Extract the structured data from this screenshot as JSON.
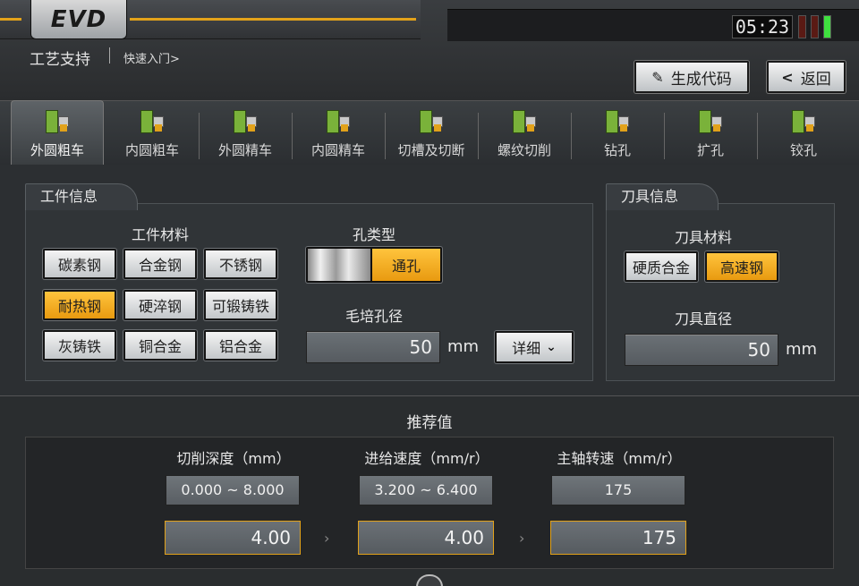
{
  "header": {
    "logo": "EVD",
    "title": "工艺支持",
    "breadcrumb": "快速入门>",
    "clock": "05:23",
    "buttons": {
      "generate": "生成代码",
      "back": "返回"
    }
  },
  "tabs": [
    {
      "label": "外圆粗车",
      "active": true
    },
    {
      "label": "内圆粗车",
      "active": false
    },
    {
      "label": "外圆精车",
      "active": false
    },
    {
      "label": "内圆精车",
      "active": false
    },
    {
      "label": "切槽及切断",
      "active": false
    },
    {
      "label": "螺纹切削",
      "active": false
    },
    {
      "label": "钻孔",
      "active": false
    },
    {
      "label": "扩孔",
      "active": false
    },
    {
      "label": "铰孔",
      "active": false
    }
  ],
  "workpiece": {
    "title": "工件信息",
    "material_label": "工件材料",
    "materials": [
      {
        "label": "碳素钢",
        "selected": false
      },
      {
        "label": "合金钢",
        "selected": false
      },
      {
        "label": "不锈钢",
        "selected": false
      },
      {
        "label": "耐热钢",
        "selected": true
      },
      {
        "label": "硬淬钢",
        "selected": false
      },
      {
        "label": "可锻铸铁",
        "selected": false
      },
      {
        "label": "灰铸铁",
        "selected": false
      },
      {
        "label": "铜合金",
        "selected": false
      },
      {
        "label": "铝合金",
        "selected": false
      }
    ],
    "hole_type_label": "孔类型",
    "hole_type_value": "通孔",
    "blank_hole_label": "毛培孔径",
    "blank_hole_value": "50",
    "unit": "mm",
    "detail_button": "详细"
  },
  "tool": {
    "title": "刀具信息",
    "material_label": "刀具材料",
    "materials": [
      {
        "label": "硬质合金",
        "selected": false
      },
      {
        "label": "高速钢",
        "selected": true
      }
    ],
    "diameter_label": "刀具直径",
    "diameter_value": "50",
    "unit": "mm"
  },
  "recommended": {
    "title": "推荐值",
    "columns": [
      {
        "label": "切削深度（mm）",
        "range": "0.000 ~ 8.000",
        "value": "4.00"
      },
      {
        "label": "进给速度（mm/r）",
        "range": "3.200 ~ 6.400",
        "value": "4.00"
      },
      {
        "label": "主轴转速（mm/r）",
        "range": "175",
        "value": "175"
      }
    ]
  },
  "colors": {
    "accent": "#e2a21a",
    "selected": "#f5b52a",
    "panel": "#303437"
  },
  "icons": {
    "edit": "edit-icon",
    "back": "chevron-left-icon",
    "dropdown": "chevron-down-icon",
    "arrow": "chevron-right-icon"
  }
}
